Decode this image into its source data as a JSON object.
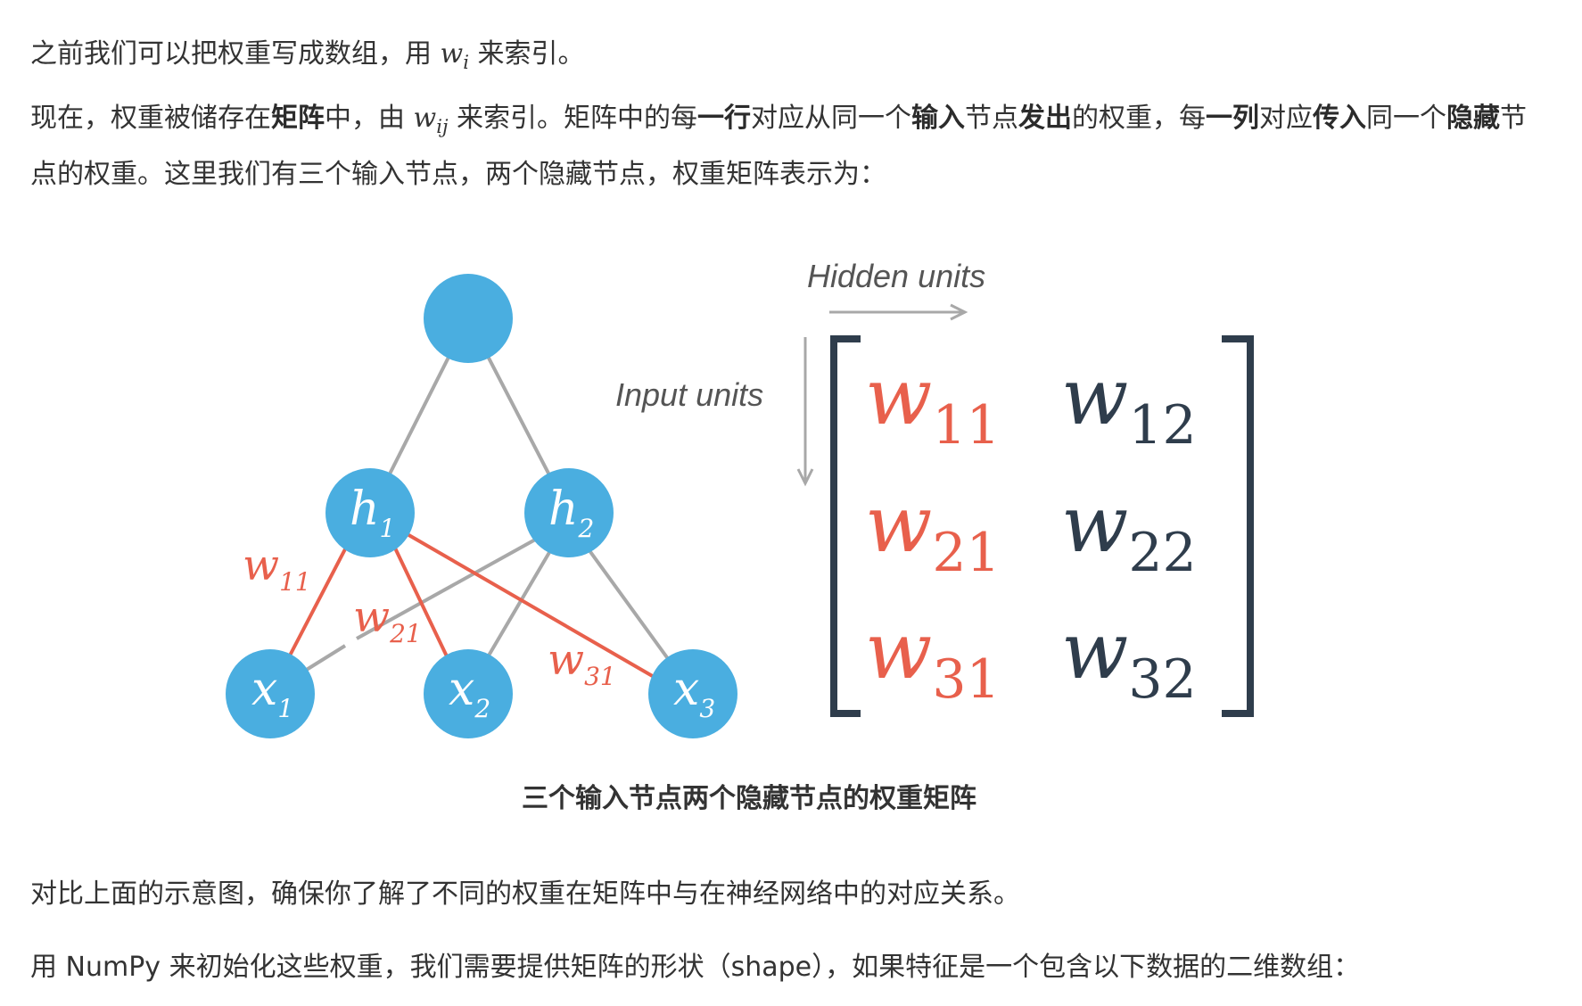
{
  "para1": {
    "before": "之前我们可以把权重写成数组，用 ",
    "math_base": "w",
    "math_sub": "i",
    "after": " 来索引。"
  },
  "para2": {
    "t1": "现在，权重被储存在",
    "b1": "矩阵",
    "t2": "中，由 ",
    "math_base": "w",
    "math_sub": "ij",
    "t3": " 来索引。矩阵中的每",
    "b2": "一行",
    "t4": "对应从同一个",
    "b3": "输入",
    "t5": "节点",
    "b4": "发出",
    "t6": "的权重，每",
    "b5": "一列",
    "t7": "对应",
    "b6": "传入",
    "t8": "同一个",
    "b7": "隐藏",
    "t9": "节点的权重。这里我们有三个输入节点，两个隐藏节点，权重矩阵表示为："
  },
  "figure": {
    "colors": {
      "node": "#4aaee0",
      "highlight": "#e8604c",
      "edge": "#a8a8a8",
      "dark": "#2f3d4c",
      "label": "#555555"
    },
    "nodes": {
      "hidden": [
        {
          "base": "h",
          "sub": "1"
        },
        {
          "base": "h",
          "sub": "2"
        }
      ],
      "inputs": [
        {
          "base": "x",
          "sub": "1"
        },
        {
          "base": "x",
          "sub": "2"
        },
        {
          "base": "x",
          "sub": "3"
        }
      ]
    },
    "edge_labels": [
      {
        "base": "w",
        "sub": "11"
      },
      {
        "base": "w",
        "sub": "21"
      },
      {
        "base": "w",
        "sub": "31"
      }
    ],
    "hidden_units_label": "Hidden units",
    "input_units_label": "Input units",
    "matrix": [
      [
        {
          "base": "w",
          "sub": "11"
        },
        {
          "base": "w",
          "sub": "12"
        }
      ],
      [
        {
          "base": "w",
          "sub": "21"
        },
        {
          "base": "w",
          "sub": "22"
        }
      ],
      [
        {
          "base": "w",
          "sub": "31"
        },
        {
          "base": "w",
          "sub": "32"
        }
      ]
    ]
  },
  "caption": "三个输入节点两个隐藏节点的权重矩阵",
  "para3": "对比上面的示意图，确保你了解了不同的权重在矩阵中与在神经网络中的对应关系。",
  "para4": "用 NumPy 来初始化这些权重，我们需要提供矩阵的形状（shape），如果特征是一个包含以下数据的二维数组："
}
